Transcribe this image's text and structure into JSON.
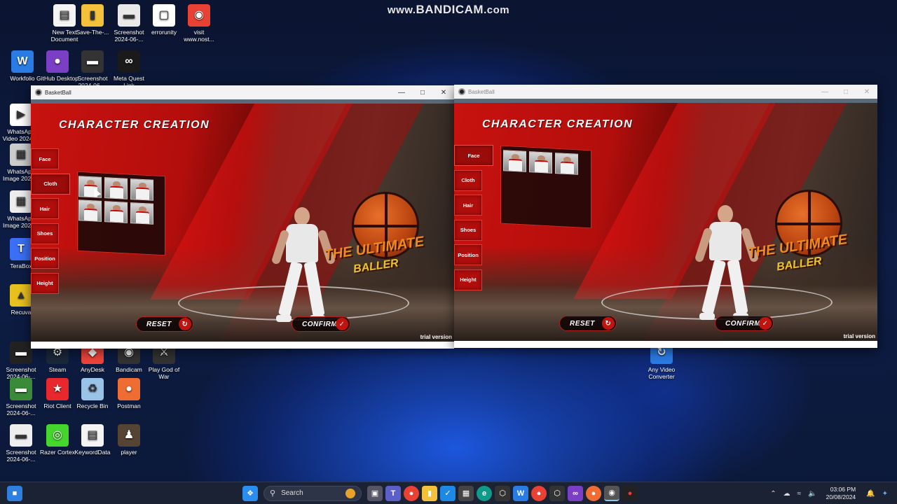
{
  "overlay": {
    "watermark_prefix": "www.",
    "watermark_main": "BANDICAM",
    "watermark_suffix": ".com"
  },
  "desktop_icons": [
    {
      "id": "new-text-document",
      "label": "New Text Document",
      "icon": "document-icon",
      "color": "#f4f4f4"
    },
    {
      "id": "save-the",
      "label": "Save-The-...",
      "icon": "folder-icon",
      "color": "#f3c23a"
    },
    {
      "id": "screenshot-top",
      "label": "Screenshot 2024-06-...",
      "icon": "screenshot-icon",
      "color": "#e9e9e9"
    },
    {
      "id": "errorunity",
      "label": "errorunity",
      "icon": "file-icon",
      "color": "#ffffff"
    },
    {
      "id": "visit",
      "label": "visit www.nost...",
      "icon": "chrome-icon",
      "color": "#e94235"
    },
    {
      "id": "workfolio",
      "label": "Workfolio",
      "icon": "workfolio-icon",
      "color": "#2a7be4"
    },
    {
      "id": "github",
      "label": "GitHub Desktop",
      "icon": "github-icon",
      "color": "#7a3fc4"
    },
    {
      "id": "screenshot-2",
      "label": "Screenshot 2024-06-...",
      "icon": "screenshot-icon",
      "color": "#333333"
    },
    {
      "id": "meta-quest",
      "label": "Meta Quest Link",
      "icon": "meta-icon",
      "color": "#1a1a1a"
    },
    {
      "id": "whatsapp-video",
      "label": "WhatsApp Video 2024-...",
      "icon": "video-icon",
      "color": "#ffffff"
    },
    {
      "id": "whatsapp-image-1",
      "label": "WhatsApp Image 2024...",
      "icon": "image-icon",
      "color": "#cccccc"
    },
    {
      "id": "whatsapp-image-2",
      "label": "WhatsApp Image 2024...",
      "icon": "image-icon",
      "color": "#eeeeee"
    },
    {
      "id": "terabox",
      "label": "TeraBox",
      "icon": "terabox-icon",
      "color": "#3b6ff5"
    },
    {
      "id": "recuva",
      "label": "Recuva",
      "icon": "recuva-icon",
      "color": "#e8c020"
    },
    {
      "id": "screenshot-3",
      "label": "Screenshot 2024-06-...",
      "icon": "screenshot-icon",
      "color": "#222222"
    },
    {
      "id": "steam",
      "label": "Steam",
      "icon": "steam-icon",
      "color": "#1b2838"
    },
    {
      "id": "anydesk",
      "label": "AnyDesk",
      "icon": "anydesk-icon",
      "color": "#ef443b"
    },
    {
      "id": "bandicam",
      "label": "Bandicam",
      "icon": "bandicam-icon",
      "color": "#333333"
    },
    {
      "id": "play-god-of-war",
      "label": "Play God of War",
      "icon": "game-icon",
      "color": "#333333"
    },
    {
      "id": "any-video-converter",
      "label": "Any Video Converter",
      "icon": "converter-icon",
      "color": "#2a7be4"
    },
    {
      "id": "screenshot-4",
      "label": "Screenshot 2024-06-...",
      "icon": "screenshot-icon",
      "color": "#3a8a3a"
    },
    {
      "id": "riot-client",
      "label": "Riot Client",
      "icon": "riot-icon",
      "color": "#e8282d"
    },
    {
      "id": "recycle-bin",
      "label": "Recycle Bin",
      "icon": "recycle-bin-icon",
      "color": "#9ac3e8"
    },
    {
      "id": "postman",
      "label": "Postman",
      "icon": "postman-icon",
      "color": "#ef6c32"
    },
    {
      "id": "screenshot-5",
      "label": "Screenshot 2024-06-...",
      "icon": "screenshot-icon",
      "color": "#eeeeee"
    },
    {
      "id": "razer-cortex",
      "label": "Razer Cortex",
      "icon": "razer-icon",
      "color": "#44d62c"
    },
    {
      "id": "keyworddata",
      "label": "KeywordData",
      "icon": "document-icon",
      "color": "#f4f4f4"
    },
    {
      "id": "player",
      "label": "player",
      "icon": "player-file-icon",
      "color": "#554433"
    }
  ],
  "windows": [
    {
      "title": "BasketBall",
      "scene_title": "CHARACTER CREATION",
      "tabs": [
        "Face",
        "Cloth",
        "Hair",
        "Shoes",
        "Position",
        "Height"
      ],
      "active_tab": "Cloth",
      "reset_label": "RESET",
      "confirm_label": "CONFIRM",
      "logo_line1": "THE ULTIMATE",
      "logo_line2": "BALLER",
      "trial": "trial version"
    },
    {
      "title": "BasketBall",
      "scene_title": "CHARACTER CREATION",
      "tabs": [
        "Face",
        "Cloth",
        "Hair",
        "Shoes",
        "Position",
        "Height"
      ],
      "active_tab": "Face",
      "reset_label": "RESET",
      "confirm_label": "CONFIRM",
      "logo_line1": "THE ULTIMATE",
      "logo_line2": "BALLER",
      "trial": "trial version"
    }
  ],
  "taskbar": {
    "search_label": "Search",
    "time": "03:06 PM",
    "date": "20/08/2024"
  },
  "colors": {
    "accent_red": "#c8120f",
    "taskbar": "#1b2233"
  }
}
